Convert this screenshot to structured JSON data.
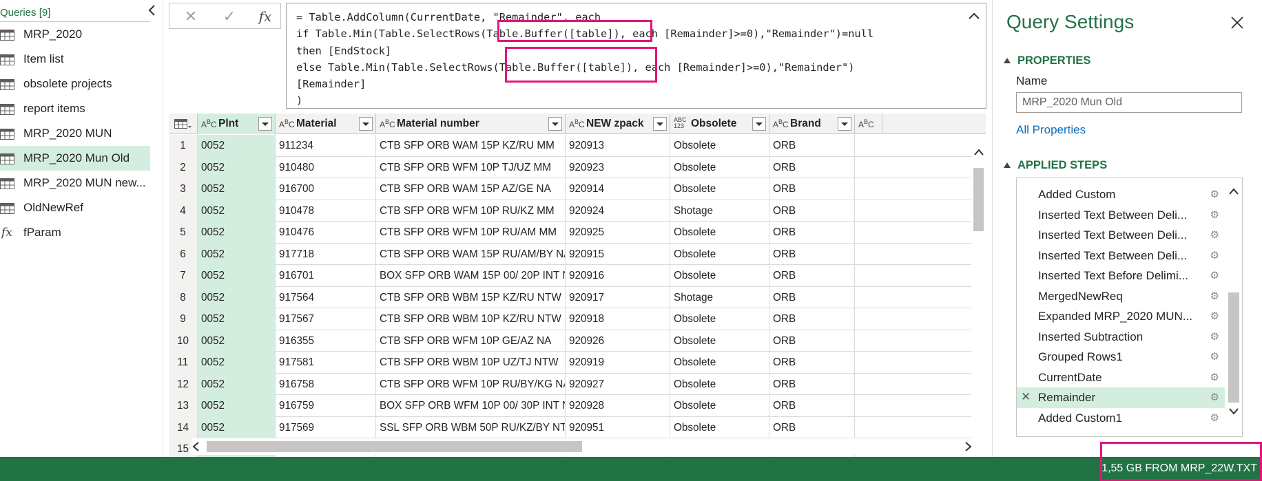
{
  "queries": {
    "header": "Queries [9]",
    "items": [
      {
        "label": "MRP_2020",
        "type": "table"
      },
      {
        "label": "Item list",
        "type": "table"
      },
      {
        "label": "obsolete projects",
        "type": "table"
      },
      {
        "label": "report items",
        "type": "table"
      },
      {
        "label": "MRP_2020 MUN",
        "type": "table"
      },
      {
        "label": "MRP_2020 Mun Old",
        "type": "table",
        "active": true
      },
      {
        "label": "MRP_2020 MUN new...",
        "type": "table"
      },
      {
        "label": "OldNewRef",
        "type": "table"
      },
      {
        "label": "fParam",
        "type": "function"
      }
    ]
  },
  "formula_bar": {
    "cancel_glyph": "✕",
    "commit_glyph": "✓",
    "fx_glyph": "fx",
    "lines": [
      "= Table.AddColumn(CurrentDate, \"Remainder\", each",
      "if Table.Min(Table.SelectRows(Table.Buffer([table]), each [Remainder]>=0),\"Remainder\")=null",
      "then [EndStock]",
      "else Table.Min(Table.SelectRows(Table.Buffer([table]), each [Remainder]>=0),\"Remainder\")",
      "[Remainder]",
      ")"
    ]
  },
  "grid": {
    "columns": [
      {
        "type": "ABC",
        "label": "Plnt"
      },
      {
        "type": "ABC",
        "label": "Material"
      },
      {
        "type": "ABC",
        "label": "Material number"
      },
      {
        "type": "ABC",
        "label": "NEW zpack"
      },
      {
        "type": "ABC123",
        "label": "Obsolete"
      },
      {
        "type": "ABC",
        "label": "Brand"
      },
      {
        "type": "ABC",
        "label": ""
      }
    ],
    "rows": [
      [
        "1",
        "0052",
        "911234",
        "CTB SFP ORB WAM 15P KZ/RU MM",
        "920913",
        "Obsolete",
        "ORB"
      ],
      [
        "2",
        "0052",
        "910480",
        "CTB SFP ORB WFM 10P TJ/UZ MM",
        "920923",
        "Obsolete",
        "ORB"
      ],
      [
        "3",
        "0052",
        "916700",
        "CTB SFP ORB WAM 15P AZ/GE NA",
        "920914",
        "Obsolete",
        "ORB"
      ],
      [
        "4",
        "0052",
        "910478",
        "CTB SFP ORB WFM 10P RU/KZ MM",
        "920924",
        "Shotage",
        "ORB"
      ],
      [
        "5",
        "0052",
        "910476",
        "CTB SFP ORB WFM 10P RU/AM MM",
        "920925",
        "Obsolete",
        "ORB"
      ],
      [
        "6",
        "0052",
        "917718",
        "CTB SFP ORB WAM 15P RU/AM/BY NA",
        "920915",
        "Obsolete",
        "ORB"
      ],
      [
        "7",
        "0052",
        "916701",
        "BOX SFP ORB WAM 15P 00/ 20P INT NA",
        "920916",
        "Obsolete",
        "ORB"
      ],
      [
        "8",
        "0052",
        "917564",
        "CTB SFP ORB WBM 15P KZ/RU NTW",
        "920917",
        "Shotage",
        "ORB"
      ],
      [
        "9",
        "0052",
        "917567",
        "CTB SFP ORB WBM 10P KZ/RU NTW",
        "920918",
        "Obsolete",
        "ORB"
      ],
      [
        "10",
        "0052",
        "916355",
        "CTB SFP ORB WFM 10P GE/AZ NA",
        "920926",
        "Obsolete",
        "ORB"
      ],
      [
        "11",
        "0052",
        "917581",
        "CTB SFP ORB WBM 10P UZ/TJ NTW",
        "920919",
        "Obsolete",
        "ORB"
      ],
      [
        "12",
        "0052",
        "916758",
        "CTB SFP ORB WFM 10P RU/BY/KG NA",
        "920927",
        "Obsolete",
        "ORB"
      ],
      [
        "13",
        "0052",
        "916759",
        "BOX SFP ORB WFM 10P 00/ 30P INT NA",
        "920928",
        "Obsolete",
        "ORB"
      ],
      [
        "14",
        "0052",
        "917569",
        "SSL SFP ORB WBM 50P RU/KZ/BY NTW",
        "920951",
        "Obsolete",
        "ORB"
      ],
      [
        "15",
        "",
        "",
        "",
        "",
        "",
        ""
      ]
    ]
  },
  "settings": {
    "title": "Query Settings",
    "properties_header": "PROPERTIES",
    "name_label": "Name",
    "name_value": "MRP_2020 Mun Old",
    "all_properties": "All Properties",
    "steps_header": "APPLIED STEPS",
    "steps": [
      {
        "label": "Added Custom"
      },
      {
        "label": "Inserted Text Between Deli..."
      },
      {
        "label": "Inserted Text Between Deli..."
      },
      {
        "label": "Inserted Text Between Deli..."
      },
      {
        "label": "Inserted Text Before Delimi..."
      },
      {
        "label": "MergedNewReq"
      },
      {
        "label": "Expanded MRP_2020 MUN..."
      },
      {
        "label": "Inserted Subtraction"
      },
      {
        "label": "Grouped Rows1"
      },
      {
        "label": "CurrentDate"
      },
      {
        "label": "Remainder",
        "active": true
      },
      {
        "label": "Added Custom1"
      }
    ]
  },
  "status": {
    "text": "1,55 GB FROM MRP_22W.TXT"
  },
  "colors": {
    "accent_green": "#217346",
    "selection_green": "#d3eedf",
    "highlight_pink": "#e2157b",
    "link_blue": "#106ebe"
  }
}
